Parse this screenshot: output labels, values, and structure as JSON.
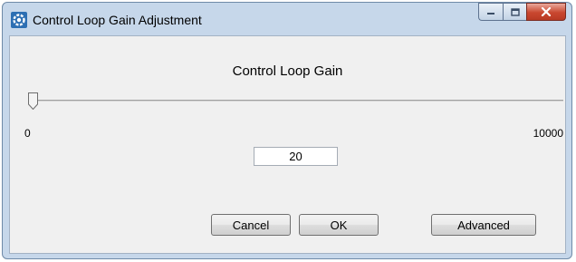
{
  "window": {
    "title": "Control Loop Gain Adjustment",
    "app_icon": "gear-icon",
    "caption_buttons": [
      "minimize-icon",
      "maximize-icon",
      "close-icon"
    ]
  },
  "dialog": {
    "heading": "Control Loop Gain",
    "slider": {
      "min_label": "0",
      "max_label": "10000",
      "min": 0,
      "max": 10000,
      "value": 20
    },
    "gain_input_value": "20",
    "buttons": {
      "cancel": "Cancel",
      "ok": "OK",
      "advanced": "Advanced"
    }
  },
  "colors": {
    "frame": "#c6d7ea",
    "client": "#f0f0f0",
    "close_button": "#c9472f"
  }
}
